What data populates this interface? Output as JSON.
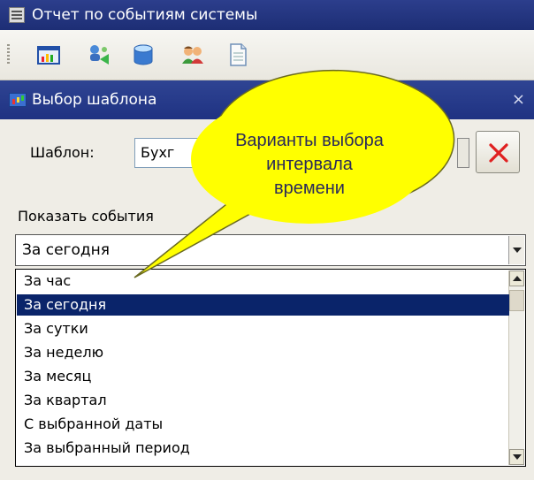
{
  "app": {
    "title": "Отчет по событиям системы",
    "toolbar": [
      "chart-icon",
      "network-users-icon",
      "database-icon",
      "users-icon",
      "document-icon"
    ]
  },
  "dialog": {
    "title": "Выбор шаблона",
    "close_label": "×",
    "template_label": "Шаблон:",
    "template_value": "Бухг",
    "show_events_label": "Показать события",
    "selected_period": "За сегодня"
  },
  "dropdown": {
    "options": [
      "За час",
      "За сегодня",
      "За сутки",
      "За неделю",
      "За месяц",
      "За квартал",
      "С выбранной даты",
      "За выбранный период"
    ],
    "selected_index": 1
  },
  "callout": {
    "lines": [
      "Варианты выбора",
      "интервала",
      "времени"
    ]
  },
  "colors": {
    "title_bar": "#2c3e8c",
    "selection": "#0a246a",
    "callout_fill": "#ffff00",
    "delete_red": "#e02020"
  }
}
